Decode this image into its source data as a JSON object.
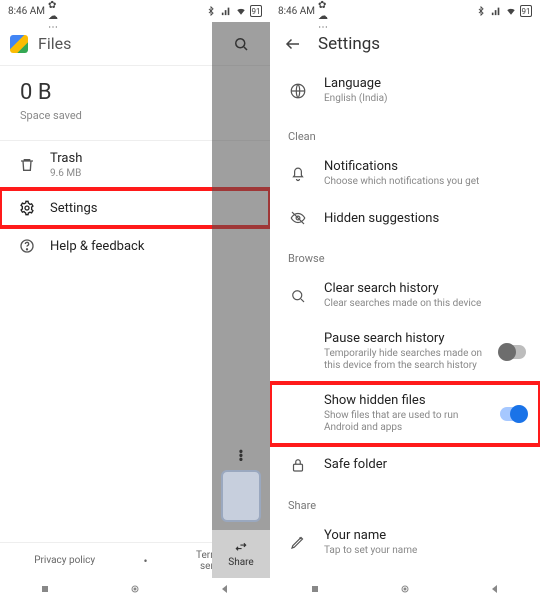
{
  "status": {
    "time": "8:46 AM",
    "battery": "91"
  },
  "left": {
    "app_title": "Files",
    "space_value": "0 B",
    "space_label": "Space saved",
    "menu": {
      "trash": {
        "title": "Trash",
        "sub": "9.6 MB"
      },
      "settings": {
        "title": "Settings"
      },
      "help": {
        "title": "Help & feedback"
      }
    },
    "footer": {
      "privacy": "Privacy policy",
      "terms1": "Terms of",
      "terms2": "service"
    },
    "share_label": "Share"
  },
  "right": {
    "title": "Settings",
    "rows": {
      "language": {
        "title": "Language",
        "sub": "English (India)"
      },
      "clean_label": "Clean",
      "notifications": {
        "title": "Notifications",
        "sub": "Choose which notifications you get"
      },
      "hidden_sugg": {
        "title": "Hidden suggestions"
      },
      "browse_label": "Browse",
      "clear_search": {
        "title": "Clear search history",
        "sub": "Clear searches made on this device"
      },
      "pause_search": {
        "title": "Pause search history",
        "sub": "Temporarily hide searches made on this device from the search history"
      },
      "show_hidden": {
        "title": "Show hidden files",
        "sub": "Show files that are used to run Android and apps"
      },
      "safe_folder": {
        "title": "Safe folder"
      },
      "share_label": "Share",
      "your_name": {
        "title": "Your name",
        "sub": "Tap to set your name"
      }
    }
  }
}
